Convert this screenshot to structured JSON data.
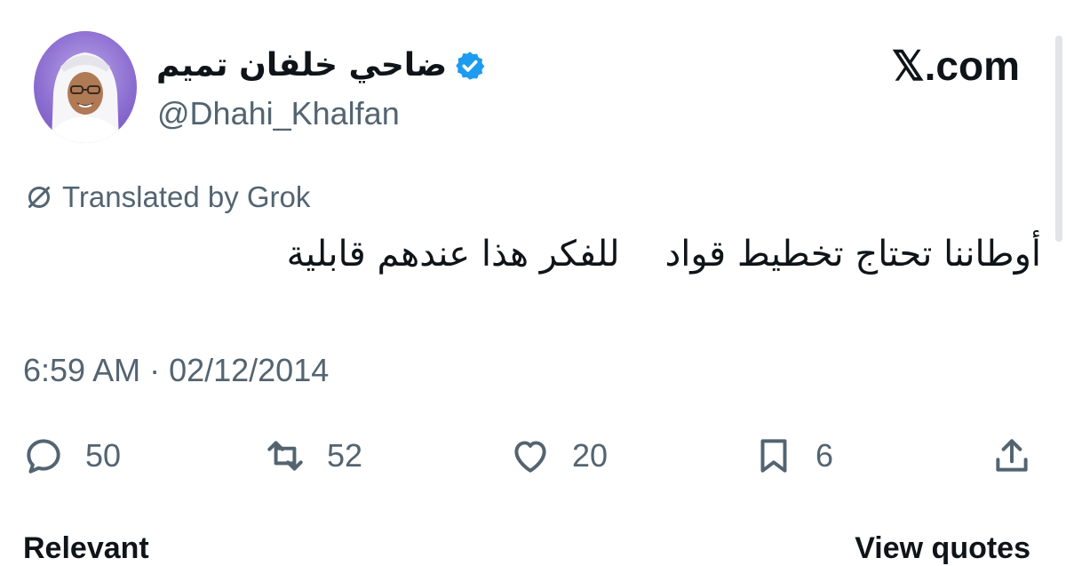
{
  "author": {
    "display_name": "ضاحي خلفان تميم",
    "handle": "@Dhahi_Khalfan",
    "verified": true
  },
  "brand": "𝕏.com",
  "translation_label": "Translated by Grok",
  "tweet": {
    "text": "أوطاننا تحتاج تخطيط قواد    للفكر هذا عندهم قابلية",
    "timestamp": "6:59 AM · 02/12/2014"
  },
  "actions": {
    "replies": "50",
    "reposts": "52",
    "likes": "20",
    "bookmarks": "6"
  },
  "partial_row": {
    "left": "Relevant",
    "right": "View quotes"
  },
  "colors": {
    "verified_blue": "#1d9bf0",
    "secondary_text": "#536471",
    "primary_text": "#0f1419"
  }
}
